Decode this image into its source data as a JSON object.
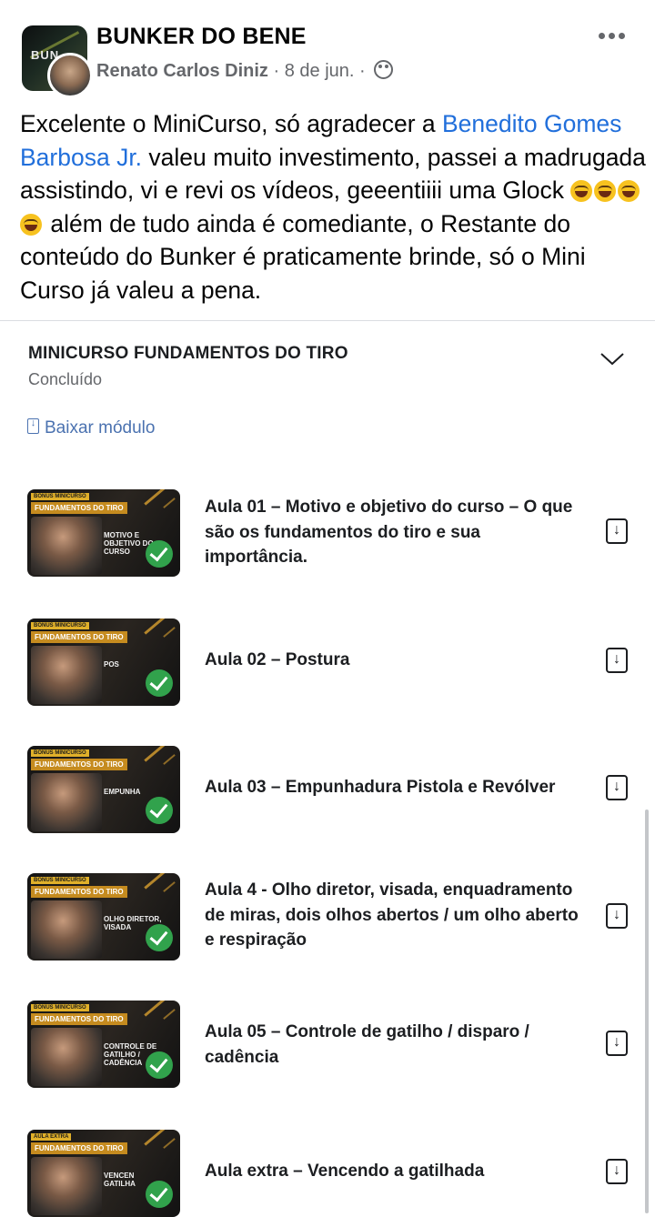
{
  "header": {
    "page_name": "BUNKER DO BENE",
    "author": "Renato Carlos Diniz",
    "separator": "·",
    "date": "8 de jun.",
    "avatar_text": "BUN"
  },
  "post": {
    "text_before": "Excelente o MiniCurso, só agradecer a ",
    "mention": "Benedito Gomes Barbosa Jr.",
    "text_middle": " valeu muito investimento, passei a madrugada assistindo, vi e revi os vídeos, geeentiiii uma Glock ",
    "emoji_count": 4,
    "text_after": " além de tudo ainda é comediante, o Restante do conteúdo do Bunker é praticamente brinde, só o Mini Curso já valeu a pena."
  },
  "module": {
    "title": "MINICURSO FUNDAMENTOS DO TIRO",
    "status": "Concluído",
    "download_label": "Baixar módulo"
  },
  "lessons": [
    {
      "title": "Aula 01 – Motivo e objetivo do curso – O que são os fundamentos do tiro e sua importância.",
      "tag": "BÔNUS MINICURSO",
      "band": "FUNDAMENTOS DO TIRO",
      "caption": "MOTIVO E OBJETIVO DO CURSO"
    },
    {
      "title": "Aula 02 – Postura",
      "tag": "BÔNUS MINICURSO",
      "band": "FUNDAMENTOS DO TIRO",
      "caption": "POS"
    },
    {
      "title": "Aula 03 – Empunhadura Pistola e Revólver",
      "tag": "BÔNUS MINICURSO",
      "band": "FUNDAMENTOS DO TIRO",
      "caption": "EMPUNHA"
    },
    {
      "title": "Aula 4 - Olho diretor, visada, enquadramento de miras, dois olhos abertos / um olho aberto e respiração",
      "tag": "BÔNUS MINICURSO",
      "band": "FUNDAMENTOS DO TIRO",
      "caption": "OLHO DIRETOR, VISADA"
    },
    {
      "title": "Aula 05 – Controle de gatilho / disparo / cadência",
      "tag": "BÔNUS MINICURSO",
      "band": "FUNDAMENTOS DO TIRO",
      "caption": "CONTROLE DE GATILHO / CADÊNCIA"
    },
    {
      "title": "Aula extra – Vencendo a gatilhada",
      "tag": "AULA EXTRA",
      "band": "FUNDAMENTOS DO TIRO",
      "caption": "VENCEN GATILHA"
    }
  ],
  "colors": {
    "mention": "#216fdb",
    "check": "#31a24c",
    "muted": "#65676b",
    "link": "#4b72b0"
  }
}
